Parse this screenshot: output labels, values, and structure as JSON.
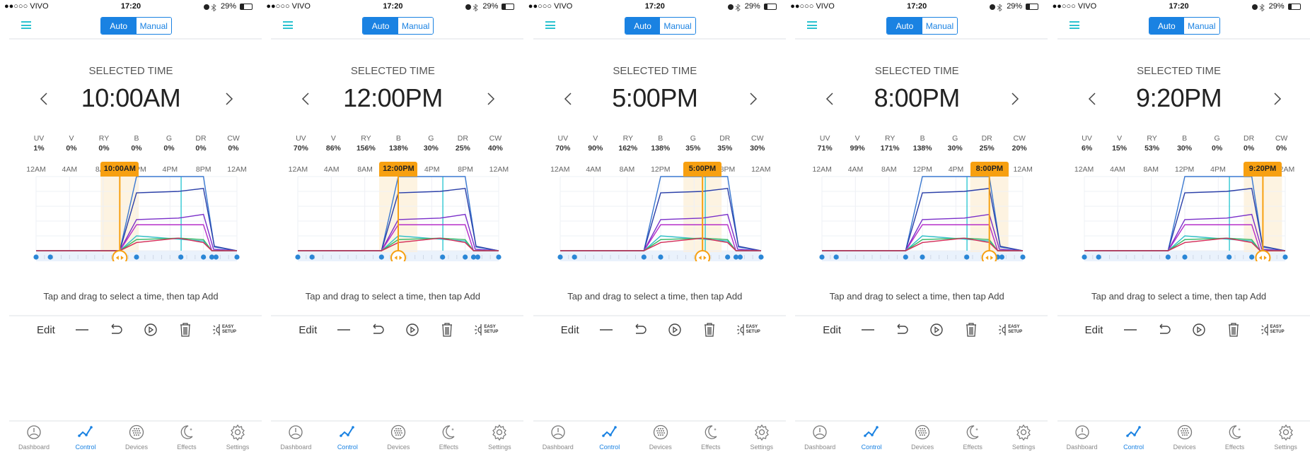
{
  "status_bar": {
    "carrier": "●●○○○ VIVO",
    "time": "17:20",
    "battery": "29%"
  },
  "mode_toggle": {
    "options": [
      "Auto",
      "Manual"
    ],
    "selected": "Auto"
  },
  "selected_time_label": "SELECTED TIME",
  "hint": "Tap and drag to select a time, then tap Add",
  "toolbar": {
    "edit_label": "Edit",
    "easy_setup_label": [
      "EASY",
      "SETUP"
    ]
  },
  "tabs": [
    {
      "label": "Dashboard",
      "icon": "gauge-icon",
      "active": false
    },
    {
      "label": "Control",
      "icon": "graph-icon",
      "active": true
    },
    {
      "label": "Devices",
      "icon": "devices-icon",
      "active": false
    },
    {
      "label": "Effects",
      "icon": "moon-icon",
      "active": false
    },
    {
      "label": "Settings",
      "icon": "gear-icon",
      "active": false
    }
  ],
  "colors": {
    "accent": "#1a82e2",
    "marker": "#f7a011",
    "current_time_line": "#21c4cf"
  },
  "channels": [
    "UV",
    "V",
    "RY",
    "B",
    "G",
    "DR",
    "CW"
  ],
  "axis_ticks": [
    "12AM",
    "4AM",
    "8AM",
    "12PM",
    "4PM",
    "8PM",
    "12AM"
  ],
  "screens": [
    {
      "selected_time": "10:00AM",
      "marker_hour": 10,
      "values": [
        "1%",
        "0%",
        "0%",
        "0%",
        "0%",
        "0%",
        "0%"
      ]
    },
    {
      "selected_time": "12:00PM",
      "marker_hour": 12,
      "values": [
        "70%",
        "86%",
        "156%",
        "138%",
        "30%",
        "25%",
        "40%"
      ]
    },
    {
      "selected_time": "5:00PM",
      "marker_hour": 17,
      "values": [
        "70%",
        "90%",
        "162%",
        "138%",
        "35%",
        "35%",
        "30%"
      ]
    },
    {
      "selected_time": "8:00PM",
      "marker_hour": 20,
      "values": [
        "71%",
        "99%",
        "171%",
        "138%",
        "30%",
        "25%",
        "20%"
      ]
    },
    {
      "selected_time": "9:20PM",
      "marker_hour": 21.33,
      "values": [
        "6%",
        "15%",
        "53%",
        "30%",
        "0%",
        "0%",
        "0%"
      ]
    }
  ],
  "chart_data": {
    "type": "line",
    "xlim": [
      0,
      24
    ],
    "ylim": [
      0,
      100
    ],
    "current_time_hour": 17.33,
    "schedule_point_hours": [
      0,
      1.7,
      10,
      12,
      17.3,
      20,
      21,
      21.5,
      24
    ],
    "series": [
      {
        "color": "#3a78d0",
        "points": [
          [
            0,
            0
          ],
          [
            10,
            0
          ],
          [
            12,
            100
          ],
          [
            20,
            100
          ],
          [
            21.3,
            5
          ],
          [
            24,
            0
          ]
        ]
      },
      {
        "color": "#2a3fa8",
        "points": [
          [
            0,
            0
          ],
          [
            10,
            0
          ],
          [
            12,
            78
          ],
          [
            17,
            80
          ],
          [
            20,
            84
          ],
          [
            21.3,
            6
          ],
          [
            24,
            0
          ]
        ]
      },
      {
        "color": "#7a2fc9",
        "points": [
          [
            0,
            0
          ],
          [
            10,
            0
          ],
          [
            12,
            42
          ],
          [
            17,
            44
          ],
          [
            20,
            49
          ],
          [
            21.2,
            2
          ],
          [
            24,
            0
          ]
        ]
      },
      {
        "color": "#b52ec8",
        "points": [
          [
            0,
            0
          ],
          [
            10,
            0
          ],
          [
            12,
            35
          ],
          [
            20,
            35
          ],
          [
            21,
            0
          ],
          [
            24,
            0
          ]
        ]
      },
      {
        "color": "#2fc0c8",
        "points": [
          [
            0,
            0
          ],
          [
            10,
            0
          ],
          [
            12,
            20
          ],
          [
            20,
            13
          ],
          [
            21,
            0
          ],
          [
            24,
            0
          ]
        ]
      },
      {
        "color": "#3bb86a",
        "points": [
          [
            0,
            0
          ],
          [
            10,
            0
          ],
          [
            12,
            15
          ],
          [
            17,
            17
          ],
          [
            20,
            15
          ],
          [
            21,
            0
          ],
          [
            24,
            0
          ]
        ]
      },
      {
        "color": "#d22a55",
        "points": [
          [
            0,
            0
          ],
          [
            10,
            0
          ],
          [
            12,
            11
          ],
          [
            17,
            17
          ],
          [
            20,
            11
          ],
          [
            21,
            0
          ],
          [
            24,
            0
          ]
        ]
      }
    ]
  }
}
